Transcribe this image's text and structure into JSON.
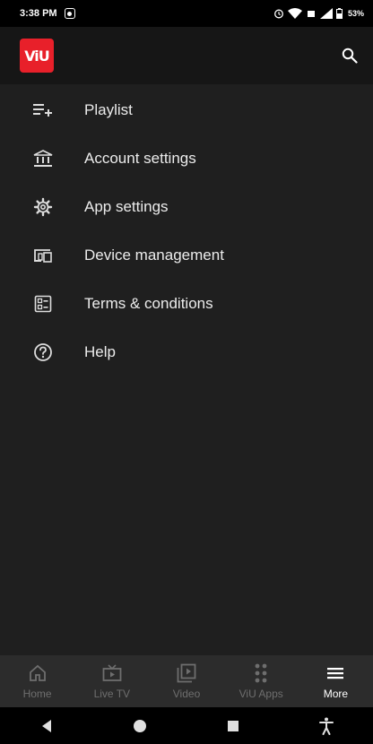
{
  "status_bar": {
    "time": "3:38 PM",
    "battery": "53%",
    "icons": [
      "alarm-icon",
      "wifi-icon",
      "signal-icon",
      "battery-icon"
    ]
  },
  "app_bar": {
    "logo_text": "ViU",
    "brand_color": "#e8202a",
    "search_icon": "search-icon"
  },
  "menu": {
    "items": [
      {
        "label": "Playlist",
        "icon": "playlist-add-icon"
      },
      {
        "label": "Account settings",
        "icon": "bank-icon"
      },
      {
        "label": "App settings",
        "icon": "gear-icon"
      },
      {
        "label": "Device management",
        "icon": "devices-icon"
      },
      {
        "label": "Terms & conditions",
        "icon": "document-list-icon"
      },
      {
        "label": "Help",
        "icon": "help-circle-icon"
      }
    ]
  },
  "bottom_nav": {
    "items": [
      {
        "label": "Home",
        "icon": "home-icon",
        "active": false
      },
      {
        "label": "Live TV",
        "icon": "tv-icon",
        "active": false
      },
      {
        "label": "Video",
        "icon": "video-library-icon",
        "active": false
      },
      {
        "label": "ViU Apps",
        "icon": "apps-grid-icon",
        "active": false
      },
      {
        "label": "More",
        "icon": "menu-icon",
        "active": true
      }
    ]
  },
  "system_nav": {
    "buttons": [
      "back-icon",
      "home-circle-icon",
      "recents-square-icon",
      "accessibility-icon"
    ]
  }
}
